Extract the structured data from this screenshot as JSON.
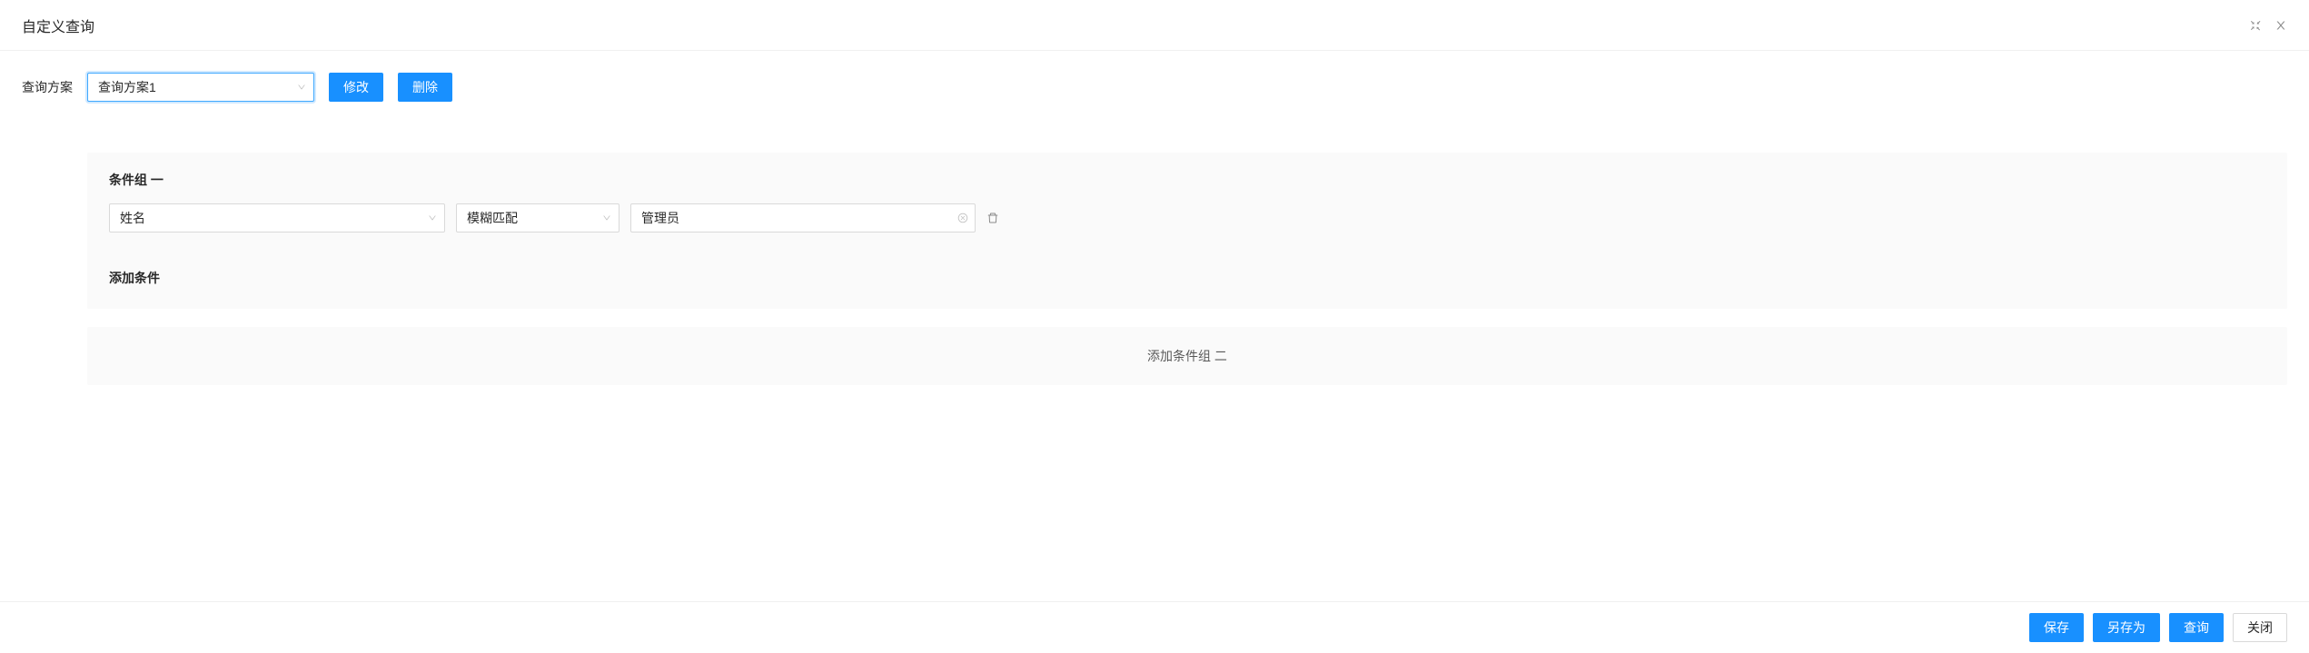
{
  "header": {
    "title": "自定义查询"
  },
  "toolbar": {
    "scheme_label": "查询方案",
    "scheme_select_value": "查询方案1",
    "edit_label": "修改",
    "delete_label": "删除"
  },
  "group": {
    "title": "条件组 一",
    "rows": [
      {
        "field": "姓名",
        "operator": "模糊匹配",
        "value": "管理员"
      }
    ],
    "add_condition_label": "添加条件"
  },
  "add_group": {
    "label": "添加条件组 二"
  },
  "footer": {
    "save_label": "保存",
    "save_as_label": "另存为",
    "query_label": "查询",
    "close_label": "关闭"
  }
}
